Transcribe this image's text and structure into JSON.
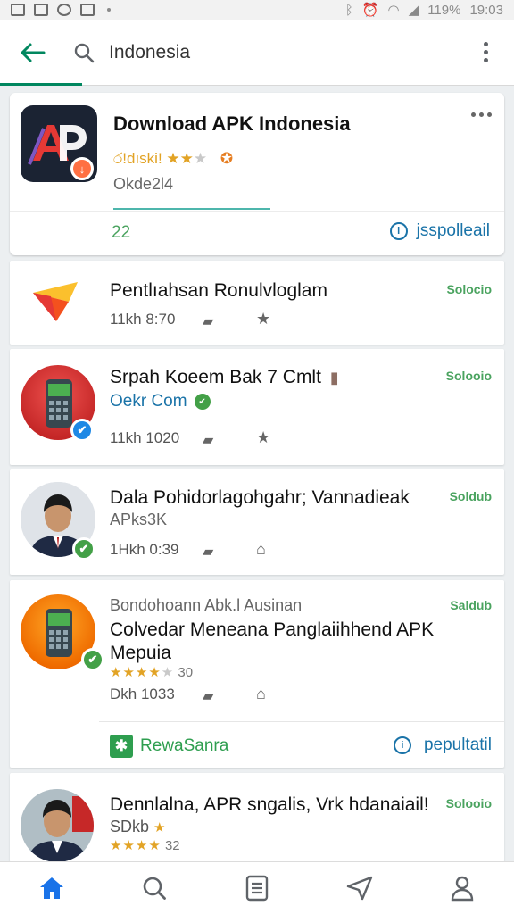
{
  "status_bar": {
    "battery": "119%",
    "time": "19:03"
  },
  "app_bar": {
    "search_query": "Indonesia"
  },
  "featured": {
    "title": "Download APK Indonesia",
    "rating_text": "රǃdıskiǃ",
    "subtitle": "Okde2l4",
    "count": "22",
    "action_label": "jsspolleail"
  },
  "apps": [
    {
      "title": "Pentlıahsan Ronulvloglam",
      "price": "Solocio",
      "meta": "11kh  8:70"
    },
    {
      "title": "Srpah Koeem Bak 7 Cmlt",
      "developer": "Oekr Com",
      "price": "Solooio",
      "meta": "11kh  1020"
    },
    {
      "title": "Dala Pohidorlagohgahr; Vannadieak",
      "subtitle": "APks3K",
      "price": "Soldub",
      "meta": "1Hkh  0:39"
    },
    {
      "pre_title": "Bondohoann Abk.l Ausinan",
      "title": "Colvedar Meneana Panglaiihhend APK",
      "title2": "Mepuia",
      "rating_value": "30",
      "price": "Saldub",
      "meta": "Dkh  1033",
      "footer_left": "RewaSanra",
      "footer_right": "pepultatil"
    },
    {
      "title": "Dennlalna, APR sngalis, Vrk hdanaiail!",
      "subtitle": "SDkb",
      "rating_value": "32",
      "price": "Solooio"
    }
  ],
  "colors": {
    "accent": "#01875f",
    "price_green": "#4aa35f",
    "link_blue": "#1a73a8",
    "star": "#e2a325"
  }
}
